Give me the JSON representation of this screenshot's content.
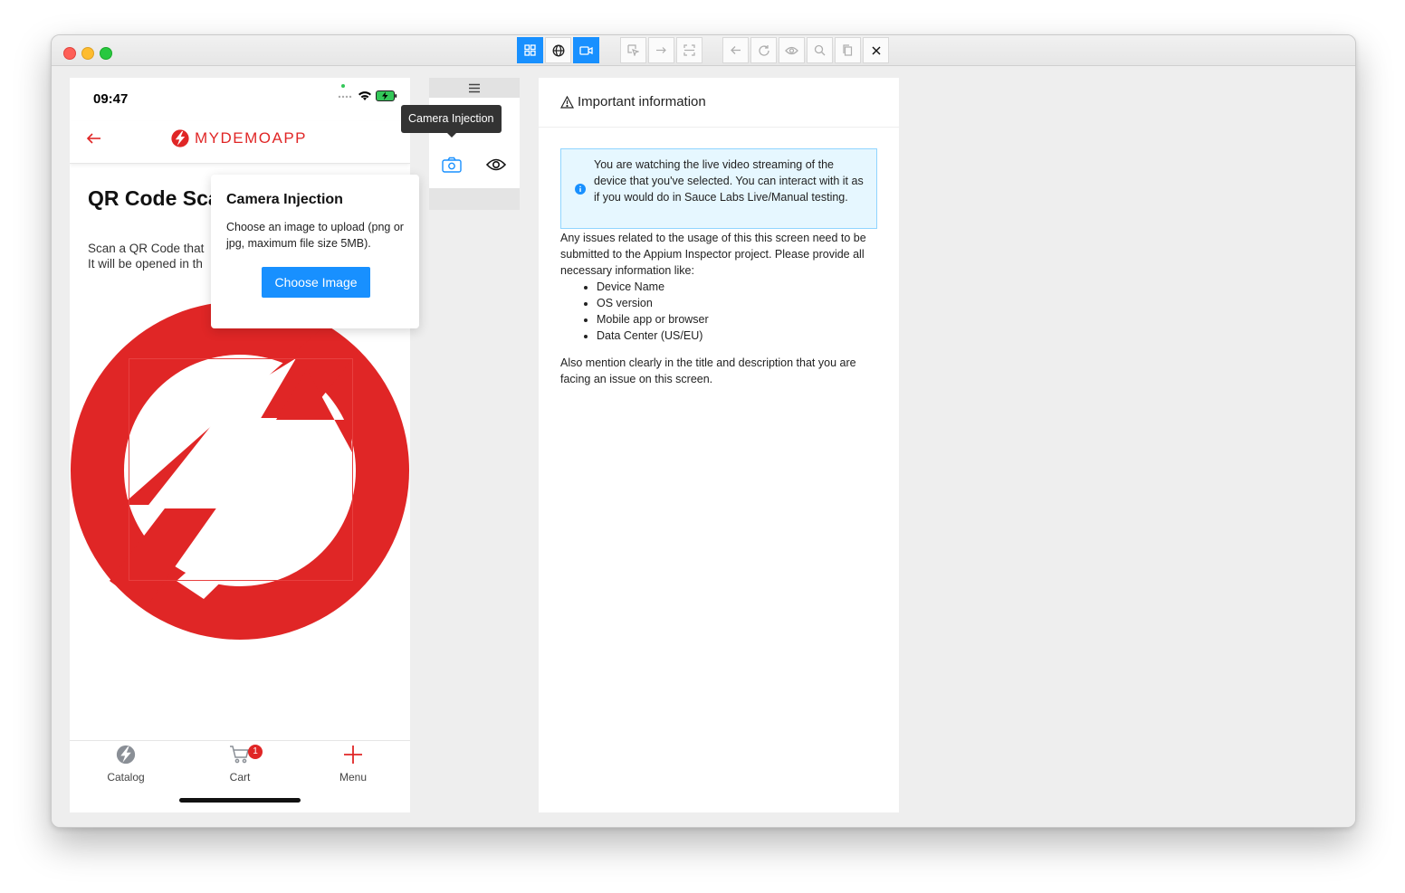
{
  "window": {
    "toolbar_buttons": [
      {
        "name": "grid-icon",
        "active": true
      },
      {
        "name": "globe-icon",
        "active": false
      },
      {
        "name": "video-icon",
        "active": true
      },
      {
        "name": "select-icon",
        "active": false
      },
      {
        "name": "swipe-icon",
        "active": false
      },
      {
        "name": "fit-icon",
        "active": false
      },
      {
        "name": "back-icon",
        "active": false
      },
      {
        "name": "refresh-icon",
        "active": false
      },
      {
        "name": "eye-icon",
        "active": false
      },
      {
        "name": "search-icon",
        "active": false
      },
      {
        "name": "copy-icon",
        "active": false
      },
      {
        "name": "close-icon",
        "active": false
      }
    ]
  },
  "device": {
    "status_time": "09:47",
    "logo_text": "MYDEMOAPP",
    "page_title": "QR Code Sca",
    "desc_line1": "Scan a QR Code that",
    "desc_line2": "It will be opened in th",
    "tabs": {
      "catalog": "Catalog",
      "cart": "Cart",
      "cart_badge": "1",
      "menu": "Menu"
    }
  },
  "popover": {
    "title": "Camera Injection",
    "text": "Choose an image to upload (png or jpg, maximum file size 5MB).",
    "button": "Choose Image"
  },
  "side_toolbar": {
    "tooltip": "Camera Injection"
  },
  "info": {
    "title": "Important information",
    "alert": "You are watching the live video streaming of the device that you've selected. You can interact with it as if you would do in Sauce Labs Live/Manual testing.",
    "paragraph1": "Any issues related to the usage of this this screen need to be submitted to the Appium Inspector project. Please provide all necessary information like:",
    "list": [
      "Device Name",
      "OS version",
      "Mobile app or browser",
      "Data Center (US/EU)"
    ],
    "paragraph2": "Also mention clearly in the title and description that you are facing an issue on this screen."
  },
  "colors": {
    "accent": "#1890ff",
    "brand_red": "#e02626",
    "alert_bg": "#e6f7ff",
    "alert_border": "#91d5ff"
  }
}
